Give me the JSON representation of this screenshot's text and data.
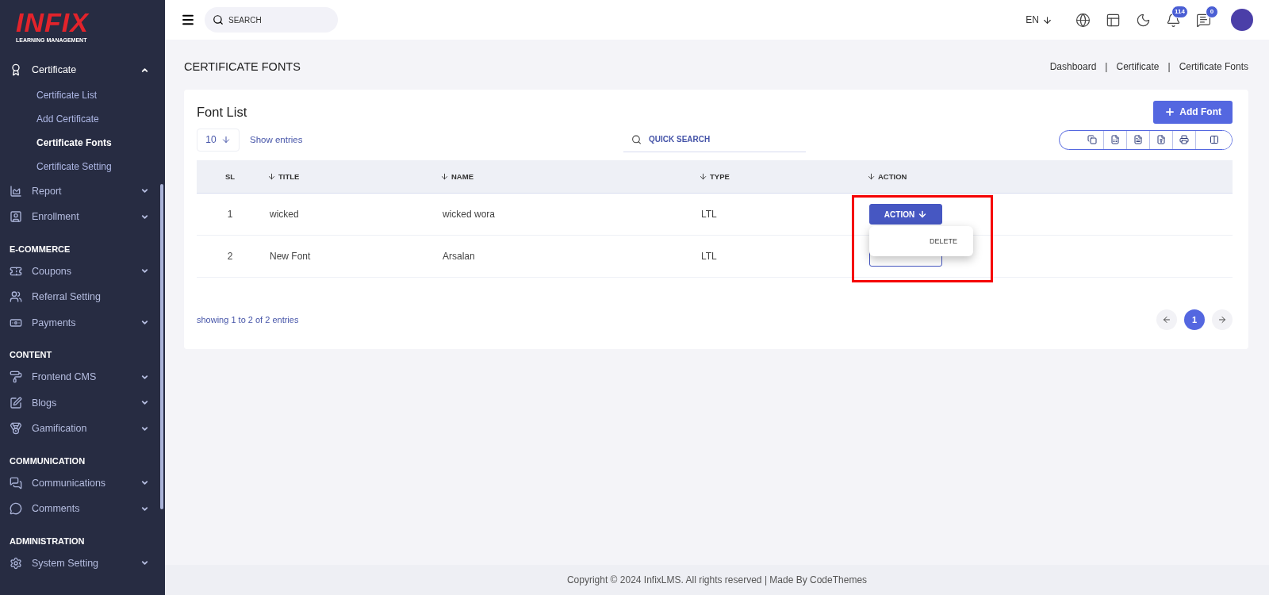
{
  "sidebar": {
    "logo": {
      "name": "INFIX",
      "tagline": "LEARNING MANAGEMENT"
    },
    "groups": [
      {
        "items": [
          {
            "label": "Certificate",
            "expanded": true,
            "children": [
              {
                "label": "Certificate List",
                "selected": false
              },
              {
                "label": "Add Certificate",
                "selected": false
              },
              {
                "label": "Certificate Fonts",
                "selected": true
              },
              {
                "label": "Certificate Setting",
                "selected": false
              }
            ]
          },
          {
            "label": "Report",
            "expanded": false
          },
          {
            "label": "Enrollment",
            "expanded": false
          }
        ]
      },
      {
        "heading": "E-COMMERCE",
        "items": [
          {
            "label": "Coupons",
            "expanded": false
          },
          {
            "label": "Referral Setting"
          },
          {
            "label": "Payments",
            "expanded": false
          }
        ]
      },
      {
        "heading": "CONTENT",
        "items": [
          {
            "label": "Frontend CMS",
            "expanded": false
          },
          {
            "label": "Blogs",
            "expanded": false
          },
          {
            "label": "Gamification",
            "expanded": false
          }
        ]
      },
      {
        "heading": "COMMUNICATION",
        "items": [
          {
            "label": "Communications",
            "expanded": false
          },
          {
            "label": "Comments",
            "expanded": false
          }
        ]
      },
      {
        "heading": "ADMINISTRATION",
        "items": [
          {
            "label": "System Setting",
            "expanded": false
          }
        ]
      }
    ]
  },
  "topbar": {
    "search": {
      "placeholder": "SEARCH"
    },
    "language": "EN",
    "notifications": "114",
    "messages": "0"
  },
  "page": {
    "title": "CERTIFICATE FONTS",
    "breadcrumb": [
      "Dashboard",
      "Certificate",
      "Certificate Fonts"
    ],
    "separator": "|"
  },
  "card": {
    "title": "Font List",
    "add_button": "Add Font",
    "page_size": "10",
    "page_size_label": "Show entries",
    "search": {
      "placeholder": "QUICK SEARCH"
    },
    "columns": [
      {
        "label": "SL",
        "sortable": false
      },
      {
        "label": "TITLE",
        "sortable": true
      },
      {
        "label": "NAME",
        "sortable": true
      },
      {
        "label": "TYPE",
        "sortable": true
      },
      {
        "label": "ACTION",
        "sortable": true
      }
    ],
    "rows": [
      {
        "sl": "1",
        "title": "wicked",
        "name": "wicked wora",
        "type": "LTL",
        "action": "ACTION",
        "highlighted": true,
        "menu_open": true,
        "menu": [
          "DELETE"
        ]
      },
      {
        "sl": "2",
        "title": "New Font",
        "name": "Arsalan",
        "type": "LTL"
      }
    ],
    "summary": "showing 1 to 2 of 2 entries",
    "pages": [
      {
        "label": "1",
        "selected": true
      }
    ]
  },
  "footer": "Copyright © 2024 InfixLMS. All rights reserved | Made By CodeThemes"
}
